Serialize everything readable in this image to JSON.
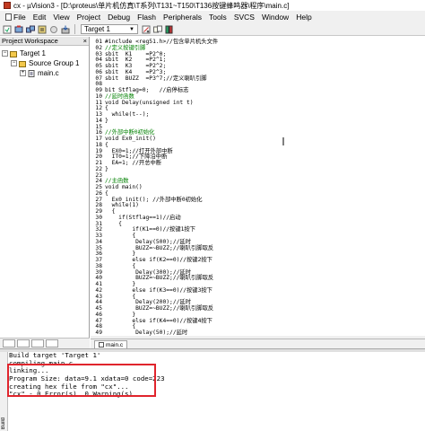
{
  "window": {
    "title": "cx - µVision3 - [D:\\proteus\\单片机仿真\\T系列\\T131~T150\\T136按键蜂鸣器\\程序\\main.c]"
  },
  "menu": {
    "items": [
      "File",
      "Edit",
      "View",
      "Project",
      "Debug",
      "Flash",
      "Peripherals",
      "Tools",
      "SVCS",
      "Window",
      "Help"
    ]
  },
  "toolbar": {
    "target_select": "Target 1",
    "icons": [
      "translate-icon",
      "build-icon",
      "rebuild-icon",
      "batch-build-icon",
      "stop-build-icon",
      "download-icon",
      "target-options-icon",
      "file-extensions-icon",
      "manage-books-icon"
    ]
  },
  "workspace": {
    "header": "Project Workspace",
    "close_glyph": "×",
    "tree": {
      "root": "Target 1",
      "group": "Source Group 1",
      "file": "main.c"
    }
  },
  "editor": {
    "lines": [
      {
        "n": "01",
        "t": "#include <reg51.h>//包含单片机头文件"
      },
      {
        "n": "02",
        "t": "//定义按键引脚",
        "c": true
      },
      {
        "n": "03",
        "t": "sbit  K1    =P2^0;"
      },
      {
        "n": "04",
        "t": "sbit  K2    =P2^1;"
      },
      {
        "n": "05",
        "t": "sbit  K3    =P2^2;"
      },
      {
        "n": "06",
        "t": "sbit  K4    =P2^3;"
      },
      {
        "n": "07",
        "t": "sbit  BUZZ  =P3^7;//定义喇叭引脚"
      },
      {
        "n": "08",
        "t": ""
      },
      {
        "n": "09",
        "t": "bit Stflag=0;   //启停标志"
      },
      {
        "n": "10",
        "t": "//延时函数",
        "c": true
      },
      {
        "n": "11",
        "t": "void Delay(unsigned int t)"
      },
      {
        "n": "12",
        "t": "{"
      },
      {
        "n": "13",
        "t": "  while(t--);"
      },
      {
        "n": "14",
        "t": "}"
      },
      {
        "n": "15",
        "t": ""
      },
      {
        "n": "16",
        "t": "//外部中断0初始化",
        "c": true
      },
      {
        "n": "17",
        "t": "void Ex0_init()"
      },
      {
        "n": "18",
        "t": "{"
      },
      {
        "n": "19",
        "t": "  EX0=1;//打开外部中断"
      },
      {
        "n": "20",
        "t": "  IT0=1;//下降沿中断"
      },
      {
        "n": "21",
        "t": "  EA=1; //开总中断"
      },
      {
        "n": "22",
        "t": "}"
      },
      {
        "n": "23",
        "t": ""
      },
      {
        "n": "24",
        "t": "//主函数",
        "c": true
      },
      {
        "n": "25",
        "t": "void main()"
      },
      {
        "n": "26",
        "t": "{"
      },
      {
        "n": "27",
        "t": "  Ex0_init(); //外部中断0初始化"
      },
      {
        "n": "28",
        "t": "  while(1)"
      },
      {
        "n": "29",
        "t": "  {"
      },
      {
        "n": "30",
        "t": "    if(Stflag==1)//启动"
      },
      {
        "n": "31",
        "t": "    {"
      },
      {
        "n": "32",
        "t": "        if(K1==0)//按键1按下"
      },
      {
        "n": "33",
        "t": "        {"
      },
      {
        "n": "34",
        "t": "         Delay(500);//延时"
      },
      {
        "n": "35",
        "t": "         BUZZ=~BUZZ;//喇叭引脚取反"
      },
      {
        "n": "36",
        "t": "        }"
      },
      {
        "n": "37",
        "t": "        else if(K2==0)//按键2按下"
      },
      {
        "n": "38",
        "t": "        {"
      },
      {
        "n": "39",
        "t": "         Delay(300);//延时"
      },
      {
        "n": "40",
        "t": "         BUZZ=~BUZZ;//喇叭引脚取反"
      },
      {
        "n": "41",
        "t": "        }"
      },
      {
        "n": "42",
        "t": "        else if(K3==0)//按键3按下"
      },
      {
        "n": "43",
        "t": "        {"
      },
      {
        "n": "44",
        "t": "         Delay(200);//延时"
      },
      {
        "n": "45",
        "t": "         BUZZ=~BUZZ;//喇叭引脚取反"
      },
      {
        "n": "46",
        "t": "        }"
      },
      {
        "n": "47",
        "t": "        else if(K4==0)//按键4按下"
      },
      {
        "n": "48",
        "t": "        {"
      },
      {
        "n": "49",
        "t": "         Delay(50);//延时"
      }
    ],
    "file_tab": "main.c"
  },
  "build": {
    "side_label": "Build",
    "lines": [
      "Build target 'Target 1'",
      "compiling main.c...",
      "linking...",
      "Program Size: data=9.1 xdata=0 code=223",
      "creating hex file from \"cx\"...",
      "\"cx\" - 0 Error(s), 0 Warning(s)."
    ]
  },
  "colors": {
    "comment": "#008000",
    "highlight_border": "#e0242c",
    "chrome": "#f0f0f0"
  }
}
